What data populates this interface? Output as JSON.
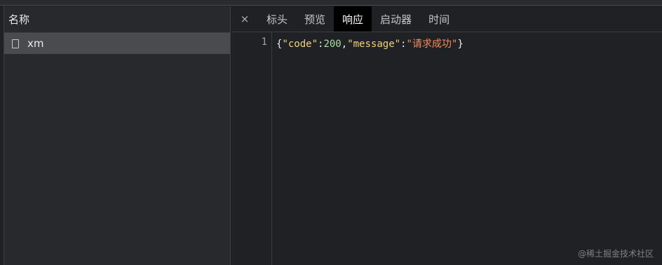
{
  "request_list": {
    "header": "名称",
    "items": [
      {
        "name": "xm",
        "icon": "document-icon"
      }
    ]
  },
  "details": {
    "close_label": "×",
    "tabs": [
      {
        "label": "标头"
      },
      {
        "label": "预览"
      },
      {
        "label": "响应",
        "active": true
      },
      {
        "label": "启动器"
      },
      {
        "label": "时间"
      }
    ]
  },
  "response": {
    "line_number": "1",
    "tokens": {
      "open_brace": "{",
      "key1": "\"code\"",
      "colon1": ":",
      "value1": "200",
      "comma": ",",
      "key2": "\"message\"",
      "colon2": ":",
      "value2": "\"请求成功\"",
      "close_brace": "}"
    }
  },
  "watermark": "@稀土掘金技术社区",
  "colors": {
    "background": "#202124",
    "active_tab": "#000000",
    "selected_row": "#4a4b4f",
    "json_key": "#f0d27a",
    "json_number": "#a6dfa1",
    "json_string": "#f28b5b"
  }
}
